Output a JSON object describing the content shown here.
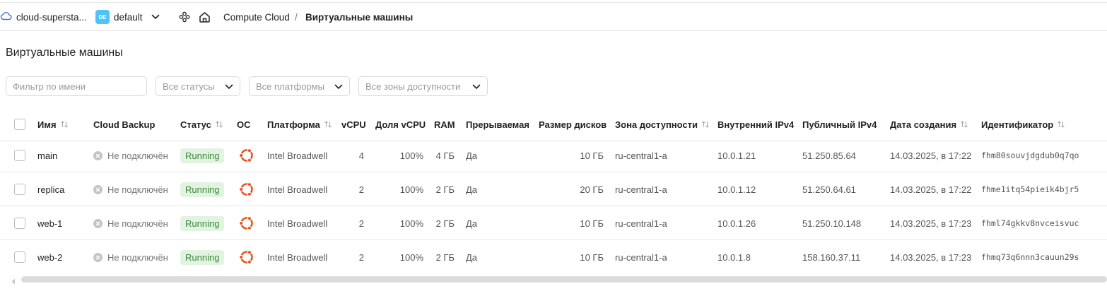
{
  "header": {
    "cloud_name": "cloud-supersta...",
    "folder_badge": "DE",
    "folder_name": "default",
    "breadcrumb": [
      "Compute Cloud",
      "/",
      "Виртуальные машины"
    ]
  },
  "page_title": "Виртуальные машины",
  "filters": {
    "name_placeholder": "Фильтр по имени",
    "status": "Все статусы",
    "platform": "Все платформы",
    "zone": "Все зоны доступности"
  },
  "table": {
    "columns": [
      "Имя",
      "Cloud Backup",
      "Статус",
      "ОС",
      "Платформа",
      "vCPU",
      "Доля vCPU",
      "RAM",
      "Прерываемая",
      "Размер дисков",
      "Зона доступности",
      "Внутренний IPv4",
      "Публичный IPv4",
      "Дата создания",
      "Идентификатор"
    ],
    "rows": [
      {
        "name": "main",
        "backup": "Не подключён",
        "status": "Running",
        "os": "ubuntu-icon",
        "platform": "Intel Broadwell",
        "vcpu": "4",
        "vcpu_share": "100%",
        "ram": "4 ГБ",
        "preemptible": "Да",
        "disk": "10 ГБ",
        "zone": "ru-central1-a",
        "internal_ip": "10.0.1.21",
        "public_ip": "51.250.85.64",
        "created": "14.03.2025, в 17:22",
        "id": "fhm80souvjdgdub0q7qo"
      },
      {
        "name": "replica",
        "backup": "Не подключён",
        "status": "Running",
        "os": "ubuntu-icon",
        "platform": "Intel Broadwell",
        "vcpu": "2",
        "vcpu_share": "100%",
        "ram": "2 ГБ",
        "preemptible": "Да",
        "disk": "20 ГБ",
        "zone": "ru-central1-a",
        "internal_ip": "10.0.1.12",
        "public_ip": "51.250.64.61",
        "created": "14.03.2025, в 17:22",
        "id": "fhme1itq54pieik4bjr5"
      },
      {
        "name": "web-1",
        "backup": "Не подключён",
        "status": "Running",
        "os": "ubuntu-icon",
        "platform": "Intel Broadwell",
        "vcpu": "2",
        "vcpu_share": "100%",
        "ram": "2 ГБ",
        "preemptible": "Да",
        "disk": "10 ГБ",
        "zone": "ru-central1-a",
        "internal_ip": "10.0.1.26",
        "public_ip": "51.250.10.148",
        "created": "14.03.2025, в 17:23",
        "id": "fhml74gkkv8nvceisvuc"
      },
      {
        "name": "web-2",
        "backup": "Не подключён",
        "status": "Running",
        "os": "ubuntu-icon",
        "platform": "Intel Broadwell",
        "vcpu": "2",
        "vcpu_share": "100%",
        "ram": "2 ГБ",
        "preemptible": "Да",
        "disk": "10 ГБ",
        "zone": "ru-central1-a",
        "internal_ip": "10.0.1.8",
        "public_ip": "158.160.37.11",
        "created": "14.03.2025, в 17:23",
        "id": "fhmq73q6nnn3cauun29s"
      }
    ]
  },
  "colors": {
    "status_running_bg": "#e2f3e2",
    "status_running_text": "#3c8a3c",
    "ubuntu_orange": "#e95420",
    "folder_badge": "#4fc3f7",
    "cloud_icon": "#3d6fd8"
  }
}
